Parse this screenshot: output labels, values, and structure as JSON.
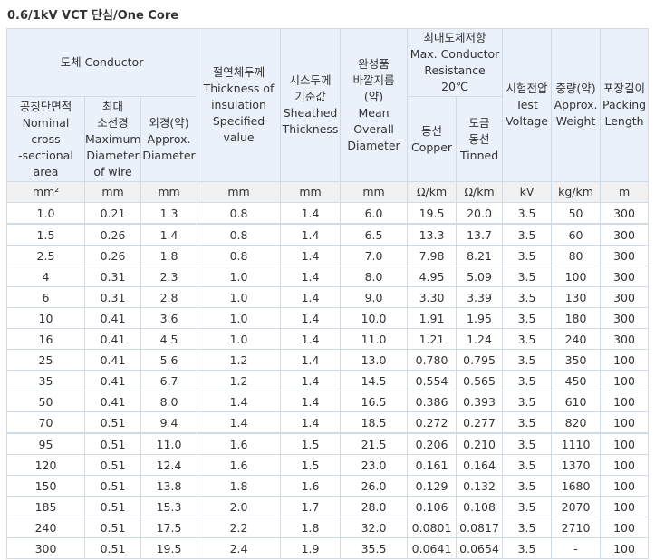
{
  "title": "0.6/1kV VCT 단심/One Core",
  "headers": {
    "conductor": "도체 Conductor",
    "nominal_area": "공칭단면적\nNominal\ncross\n-sectional\narea",
    "max_wire_dia": "최대\n소선경\nMaximum\nDiameter\nof wire",
    "approx_dia": "외경(약)\nApprox.\nDiameter",
    "insulation": "절연체두께\nThickness of\ninsulation\nSpecified\nvalue",
    "sheath": "시스두께\n기준값\nSheathed\nThickness",
    "overall_dia": "완성품\n바깥지름\n(약)\nMean\nOverall\nDiameter",
    "resistance": "최대도체저항\nMax. Conductor\nResistance\n20℃",
    "copper": "동선\nCopper",
    "tinned": "도금\n동선\nTinned",
    "test_voltage": "시험전압\nTest\nVoltage",
    "weight": "중량(약)\nApprox.\nWeight",
    "packing": "포장길이\nPacking\nLength"
  },
  "units": [
    "mm²",
    "mm",
    "mm",
    "mm",
    "mm",
    "mm",
    "Ω/km",
    "Ω/km",
    "kV",
    "kg/km",
    "m"
  ],
  "rows": [
    [
      "1.0",
      "0.21",
      "1.3",
      "0.8",
      "1.4",
      "6.0",
      "19.5",
      "20.0",
      "3.5",
      "50",
      "300"
    ],
    [
      "1.5",
      "0.26",
      "1.4",
      "0.8",
      "1.4",
      "6.5",
      "13.3",
      "13.7",
      "3.5",
      "60",
      "300"
    ],
    [
      "2.5",
      "0.26",
      "1.8",
      "0.8",
      "1.4",
      "7.0",
      "7.98",
      "8.21",
      "3.5",
      "80",
      "300"
    ],
    [
      "4",
      "0.31",
      "2.3",
      "1.0",
      "1.4",
      "8.0",
      "4.95",
      "5.09",
      "3.5",
      "100",
      "300"
    ],
    [
      "6",
      "0.31",
      "2.8",
      "1.0",
      "1.4",
      "9.0",
      "3.30",
      "3.39",
      "3.5",
      "130",
      "300"
    ],
    [
      "10",
      "0.41",
      "3.6",
      "1.0",
      "1.4",
      "10.0",
      "1.91",
      "1.95",
      "3.5",
      "180",
      "300"
    ],
    [
      "16",
      "0.41",
      "4.5",
      "1.0",
      "1.4",
      "11.0",
      "1.21",
      "1.24",
      "3.5",
      "240",
      "300"
    ],
    [
      "25",
      "0.41",
      "5.6",
      "1.2",
      "1.4",
      "13.0",
      "0.780",
      "0.795",
      "3.5",
      "350",
      "100"
    ],
    [
      "35",
      "0.41",
      "6.7",
      "1.2",
      "1.4",
      "14.5",
      "0.554",
      "0.565",
      "3.5",
      "450",
      "100"
    ],
    [
      "50",
      "0.41",
      "8.0",
      "1.4",
      "1.4",
      "16.5",
      "0.386",
      "0.393",
      "3.5",
      "610",
      "100"
    ],
    [
      "70",
      "0.51",
      "9.4",
      "1.4",
      "1.4",
      "18.5",
      "0.272",
      "0.277",
      "3.5",
      "820",
      "100"
    ],
    [
      "95",
      "0.51",
      "11.0",
      "1.6",
      "1.5",
      "21.5",
      "0.206",
      "0.210",
      "3.5",
      "1110",
      "100"
    ],
    [
      "120",
      "0.51",
      "12.4",
      "1.6",
      "1.5",
      "23.0",
      "0.161",
      "0.164",
      "3.5",
      "1370",
      "100"
    ],
    [
      "150",
      "0.51",
      "13.8",
      "1.8",
      "1.6",
      "26.0",
      "0.129",
      "0.132",
      "3.5",
      "1680",
      "100"
    ],
    [
      "185",
      "0.51",
      "15.3",
      "2.0",
      "1.7",
      "28.0",
      "0.106",
      "0.108",
      "3.5",
      "2070",
      "100"
    ],
    [
      "240",
      "0.51",
      "17.5",
      "2.2",
      "1.8",
      "32.0",
      "0.0801",
      "0.0817",
      "3.5",
      "2710",
      "100"
    ],
    [
      "300",
      "0.51",
      "19.5",
      "2.4",
      "1.9",
      "35.5",
      "0.0641",
      "0.0654",
      "3.5",
      "-",
      "100"
    ]
  ]
}
